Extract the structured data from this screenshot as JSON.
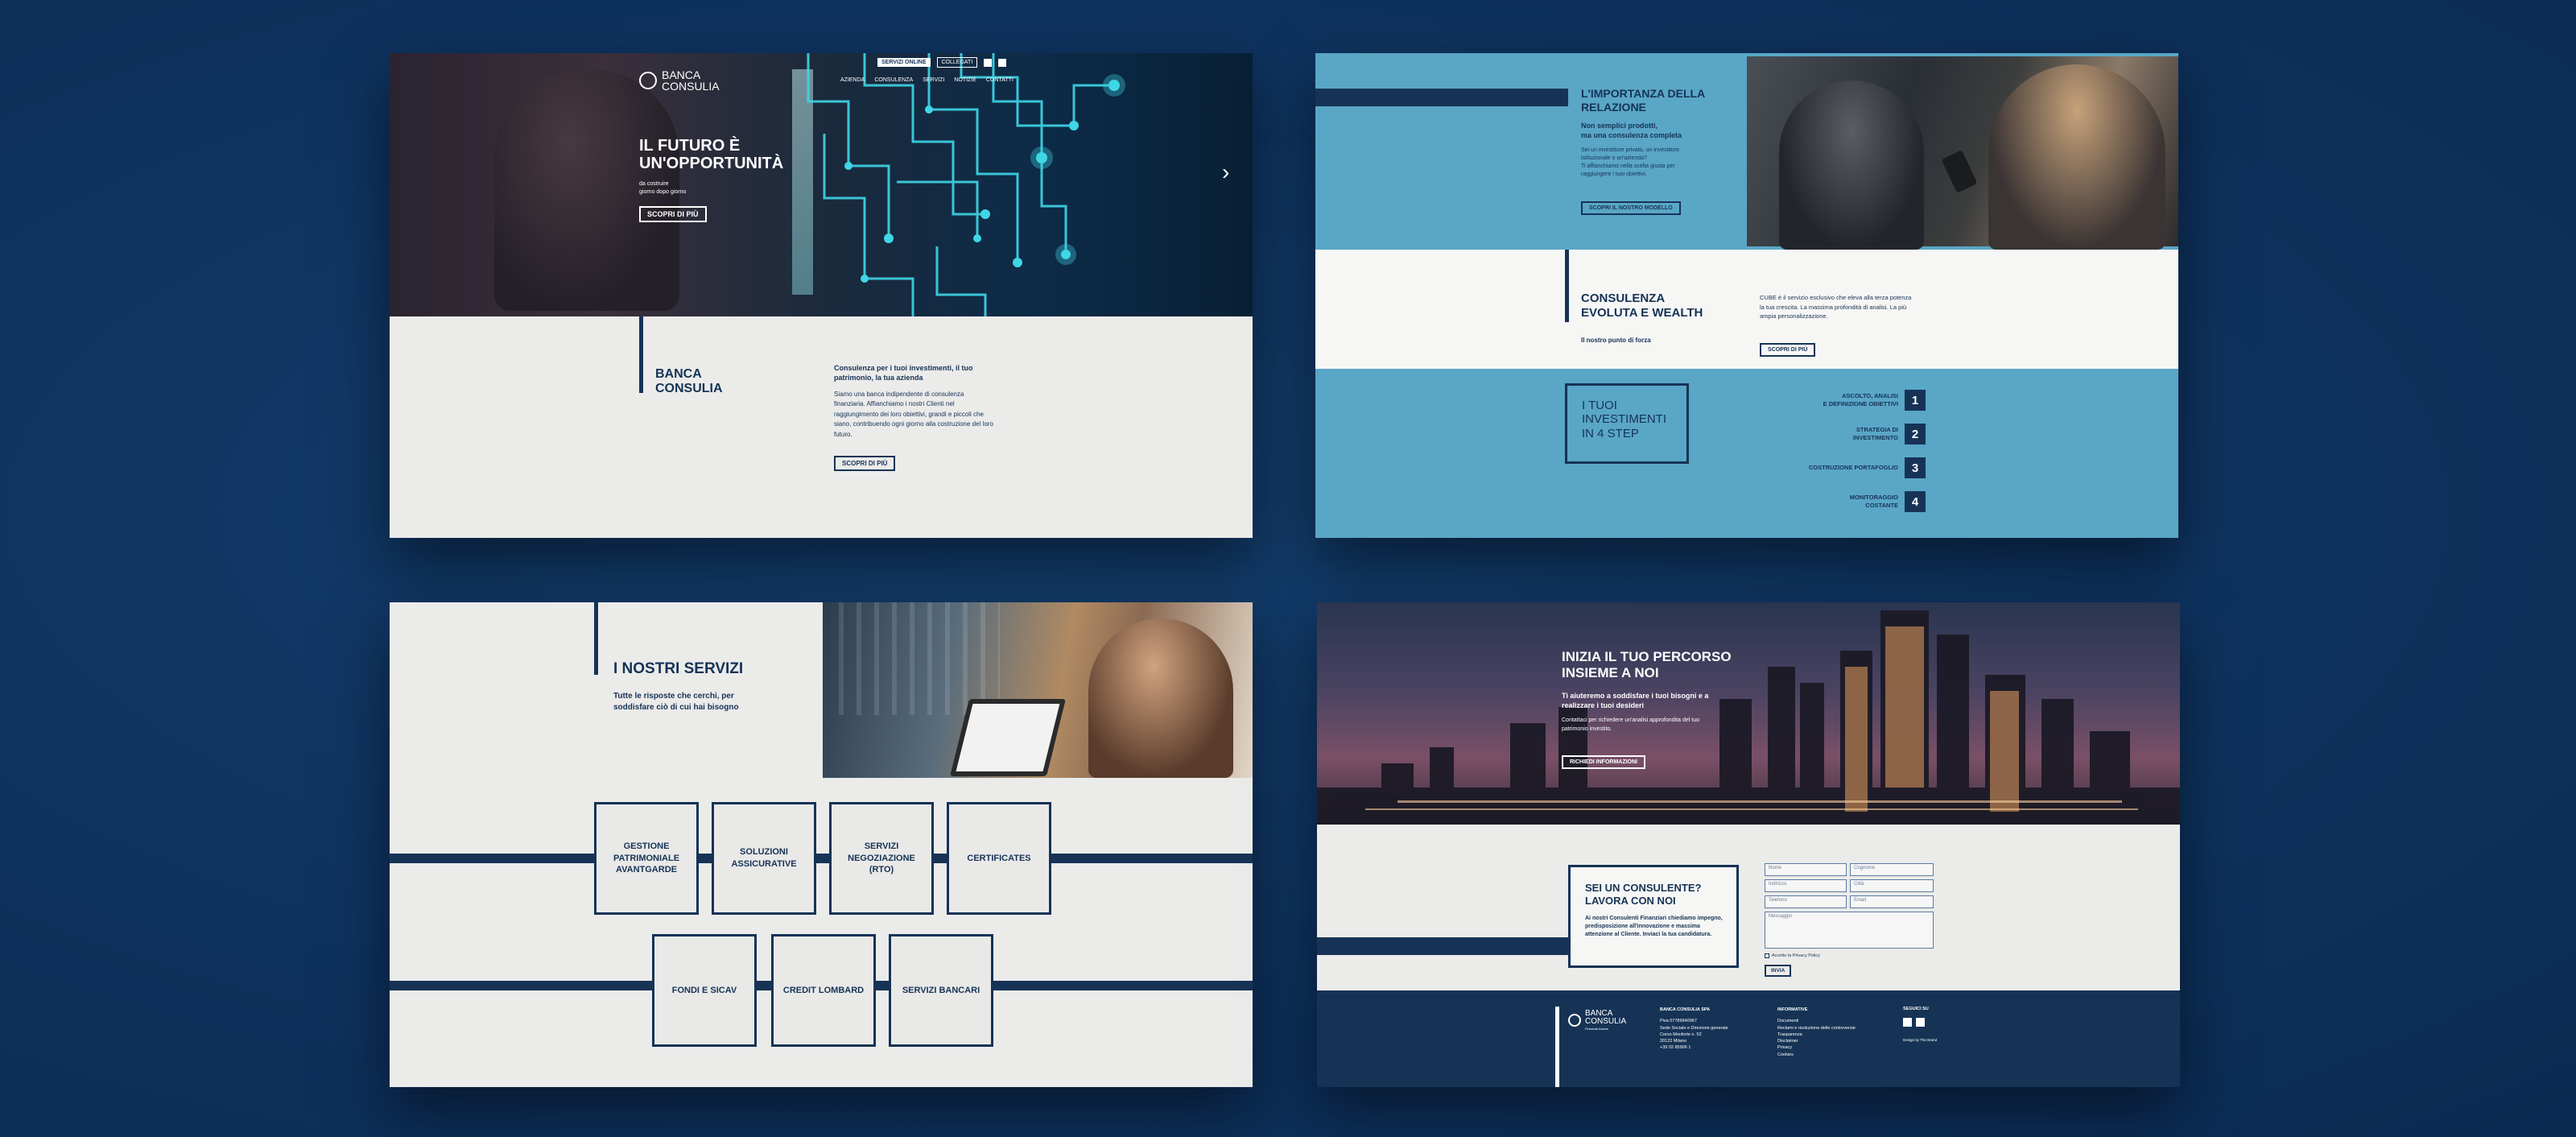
{
  "hero": {
    "logo_line1": "BANCA",
    "logo_line2": "CONSULIA",
    "top_links": [
      "SERVIZI ONLINE",
      "COLLEGATI"
    ],
    "nav": [
      "AZIENDA",
      "CONSULENZA",
      "SERVIZI",
      "NOTIZIE",
      "CONTATTI"
    ],
    "title_line1": "IL FUTURO È",
    "title_line2": "UN'OPPORTUNITÀ",
    "subtitle_line1": "da costruire",
    "subtitle_line2": "giorno dopo giorno",
    "cta": "SCOPRI DI PIÙ",
    "next_arrow": "›"
  },
  "about": {
    "title_line1": "BANCA",
    "title_line2": "CONSULIA",
    "headline": "Consulenza per i tuoi investimenti, il tuo patrimonio, la tua azienda",
    "body": "Siamo una banca indipendente di consulenza finanziaria. Affianchiamo i nostri Clienti nel raggiungimento dei loro obiettivi, grandi e piccoli che siano, contribuendo ogni giorno alla costruzione del loro futuro.",
    "cta": "SCOPRI DI PIÙ"
  },
  "relation": {
    "title_line1": "L'IMPORTANZA DELLA",
    "title_line2": "RELAZIONE",
    "sub_line1": "Non semplici prodotti,",
    "sub_line2": "ma una consulenza completa",
    "body_line1": "Sei un investitore privato, un investitore istituzionale o un'azienda?",
    "body_line2": "Ti affianchiamo nella scelta giusta per raggiungere i tuoi obiettivi.",
    "cta": "SCOPRI IL NOSTRO MODELLO"
  },
  "wealth": {
    "title_line1": "CONSULENZA",
    "title_line2": "EVOLUTA E WEALTH",
    "sub": "Il nostro punto di forza",
    "body": "CUBE è il servizio esclusivo che eleva alla terza potenza la tua crescita. La massima profondità di analisi. La più ampia personalizzazione.",
    "cta": "SCOPRI DI PIÙ"
  },
  "steps": {
    "title_line1": "I TUOI",
    "title_line2": "INVESTIMENTI",
    "title_line3": "IN 4 STEP",
    "items": [
      {
        "line1": "ASCOLTO, ANALISI",
        "line2": "E DEFINIZIONE OBIETTIVI",
        "num": "1"
      },
      {
        "line1": "STRATEGIA DI",
        "line2": "INVESTIMENTO",
        "num": "2"
      },
      {
        "line1": "COSTRUZIONE PORTAFOGLIO",
        "line2": "",
        "num": "3"
      },
      {
        "line1": "MONITORAGGIO",
        "line2": "COSTANTE",
        "num": "4"
      }
    ]
  },
  "services": {
    "title": "I NOSTRI SERVIZI",
    "sub_line1": "Tutte le risposte che cerchi, per",
    "sub_line2": "soddisfare ciò di cui hai bisogno",
    "row1": [
      "GESTIONE PATRIMONIALE AVANTGARDE",
      "SOLUZIONI ASSICURATIVE",
      "SERVIZI NEGOZIAZIONE (RTO)",
      "CERTIFICATES"
    ],
    "row2": [
      "FONDI E SICAV",
      "CREDIT LOMBARD",
      "SERVIZI BANCARI"
    ]
  },
  "journey": {
    "title_line1": "INIZIA IL TUO PERCORSO",
    "title_line2": "INSIEME A NOI",
    "sub_line1": "Ti aiuteremo a soddisfare i tuoi bisogni e a",
    "sub_line2": "realizzare i tuoi desideri",
    "body_line1": "Contattaci per richiedere un'analisi approfondita del tuo",
    "body_line2": "patrimonio investito.",
    "cta": "RICHIEDI INFORMAZIONI"
  },
  "recruit": {
    "title_line1": "SEI UN CONSULENTE?",
    "title_line2": "LAVORA CON NOI",
    "body": "Ai nostri Consulenti Finanziari chiediamo impegno, predisposizione all'innovazione e massima attenzione al Cliente. Inviaci la tua candidatura.",
    "fields": [
      "Nome",
      "Cognome",
      "Indirizzo",
      "Città",
      "Telefono",
      "Email"
    ],
    "message_placeholder": "Messaggio",
    "privacy": "Accetto la Privacy Policy",
    "submit": "INVIA"
  },
  "footer": {
    "logo_line1": "BANCA",
    "logo_line2": "CONSULIA",
    "logo_tag": "Financial Advice",
    "col1_title": "BANCA CONSULIA SPA",
    "col1_lines": [
      "Piva 07789940967",
      "Sede Sociale e Direzione generale",
      "Corso Monforte n. 52",
      "20122 Milano",
      "+39 02 85906 1"
    ],
    "col2_title": "INFORMATIVE",
    "col2_lines": [
      "Documenti",
      "Reclami e risoluzione delle controversie",
      "Trasparenza",
      "Disclaimer",
      "Privacy",
      "Cookies"
    ],
    "col3_title": "SEGUICI SU",
    "credit": "Design by The Brand"
  },
  "colors": {
    "navy": "#163356",
    "sky": "#5aa6c6",
    "light": "#ebebea",
    "neon": "#3fd6e6"
  }
}
